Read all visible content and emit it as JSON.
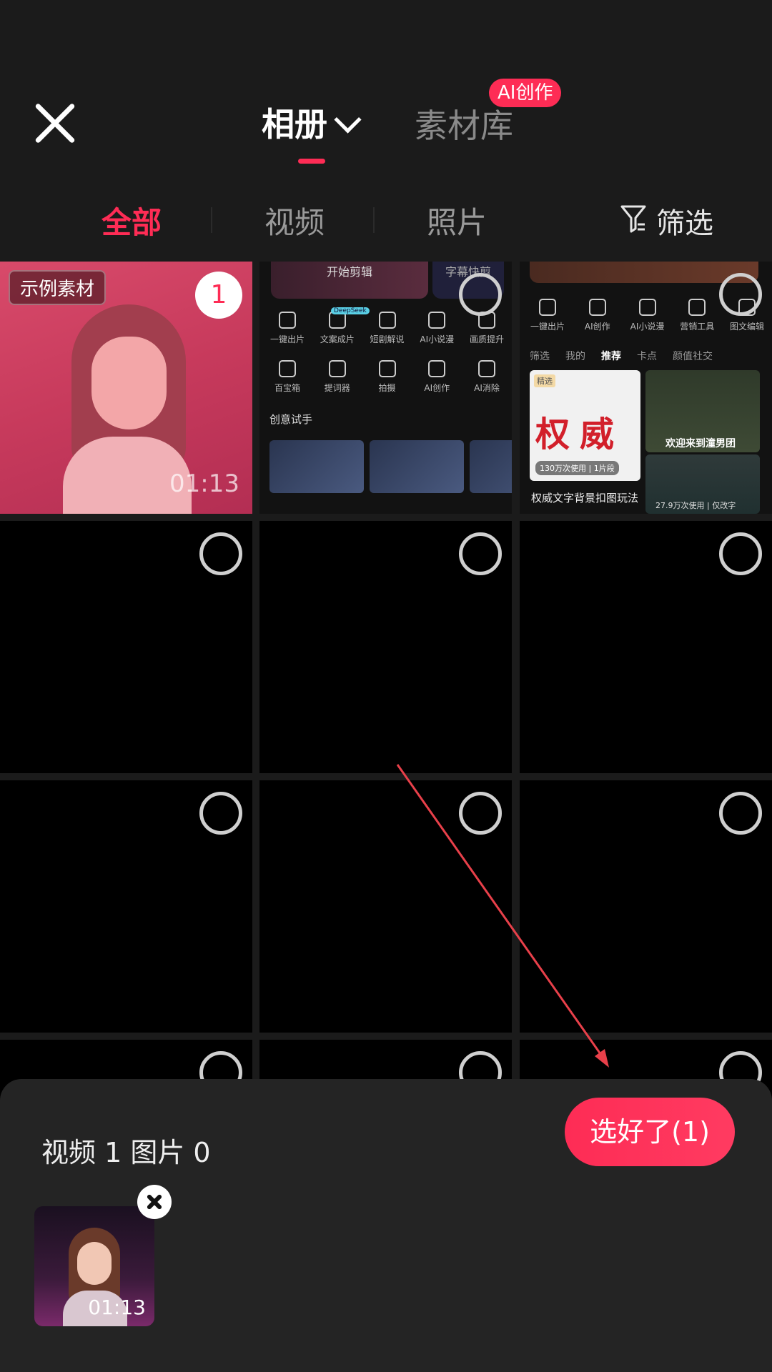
{
  "header": {
    "tab_album": "相册",
    "tab_library": "素材库",
    "ai_badge": "AI创作"
  },
  "filters": {
    "all": "全部",
    "video": "视频",
    "photo": "照片",
    "screen": "筛选"
  },
  "grid": {
    "first_item": {
      "tag": "示例素材",
      "selection_number": "1",
      "duration": "01:13"
    },
    "screenshot_2": {
      "banner_left": "开始剪辑",
      "banner_right": "字幕快剪",
      "row1": [
        "一键出片",
        "文案成片",
        "短剧解说",
        "AI小说漫",
        "画质提升"
      ],
      "row2": [
        "百宝箱",
        "提词器",
        "拍摄",
        "AI创作",
        "AI消除"
      ],
      "section_title": "创意试手",
      "badge": "DeepSeek"
    },
    "screenshot_3": {
      "row1": [
        "一键出片",
        "AI创作",
        "AI小说漫",
        "营销工具",
        "图文编辑"
      ],
      "tabs": [
        "筛选",
        "我的",
        "推荐",
        "卡点",
        "颜值社交"
      ],
      "card_a_pick": "精选",
      "card_a_big": "权威",
      "card_a_uses": "130万次使用 | 1片段",
      "card_a_caption": "权威文字背景扣图玩法",
      "card_b_text": "欢迎来到潼男团",
      "card_c_text": "27.9万次使用 | 仅改字"
    }
  },
  "bottom": {
    "counts": "视频 1  图片 0",
    "done_button": "选好了(1)",
    "selected_duration": "01:13"
  },
  "colors": {
    "accent": "#fe2c55",
    "background": "#1b1b1b"
  }
}
